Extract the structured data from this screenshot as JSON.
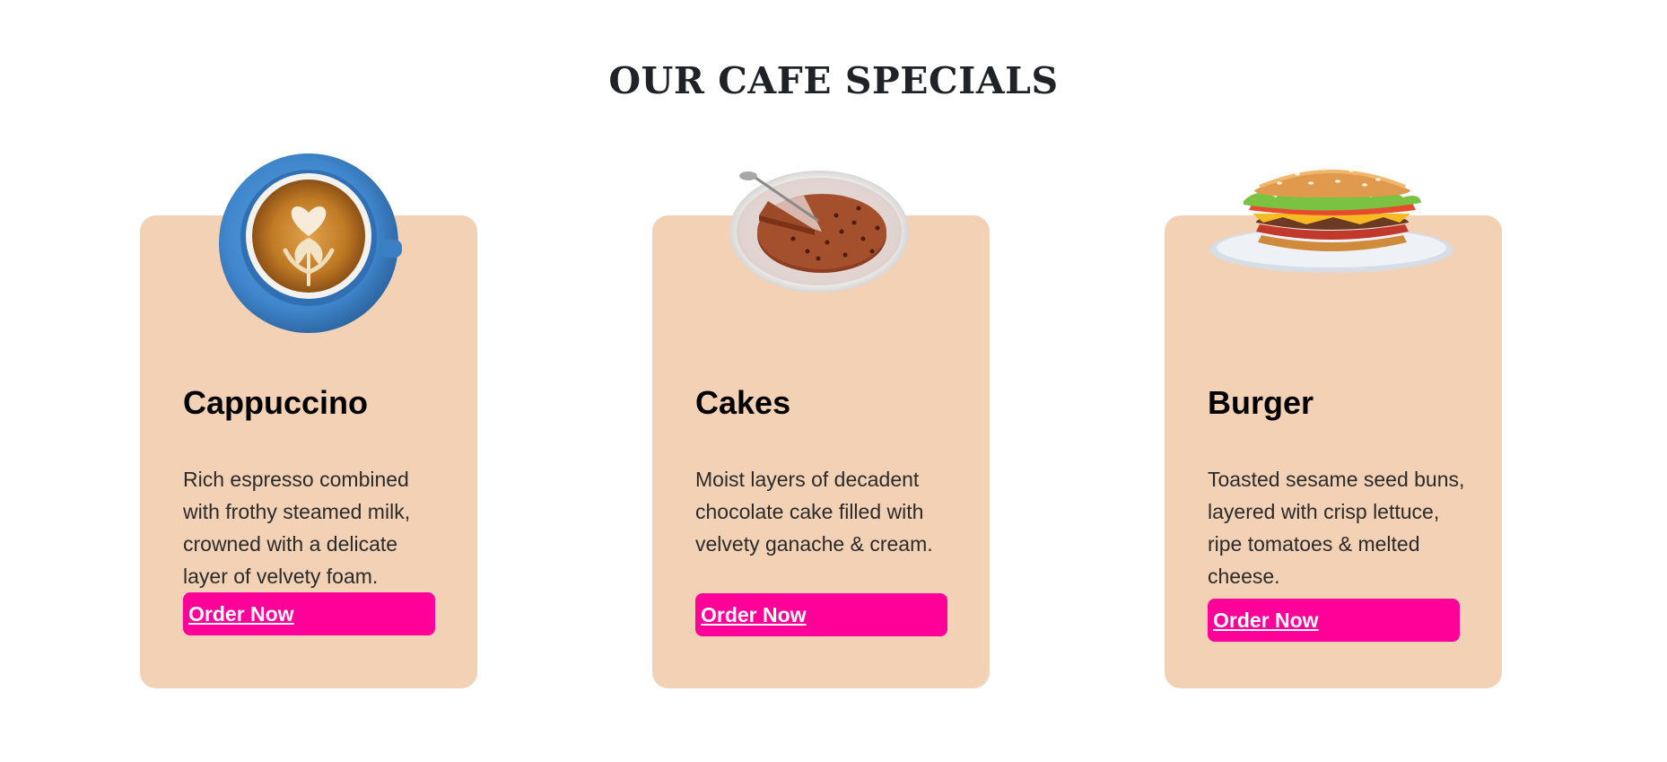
{
  "section_title": "OUR CAFE SPECIALS",
  "colors": {
    "card_background": "#f3d1b4",
    "button_background": "#ff0099",
    "button_text": "#ffffff",
    "title_text": "#1f2328"
  },
  "cards": [
    {
      "name": "Cappuccino",
      "description": "Rich espresso combined with frothy steamed milk, crowned with a delicate layer of velvety foam.",
      "button_label": "Order Now",
      "image_icon": "cappuccino-cup-icon"
    },
    {
      "name": "Cakes",
      "description": "Moist layers of decadent chocolate cake filled with velvety ganache & cream.",
      "button_label": "Order Now",
      "image_icon": "chocolate-cake-icon"
    },
    {
      "name": "Burger",
      "description": "Toasted sesame seed buns, layered with crisp lettuce, ripe tomatoes & melted cheese.",
      "button_label": "Order Now",
      "image_icon": "burger-icon"
    }
  ]
}
